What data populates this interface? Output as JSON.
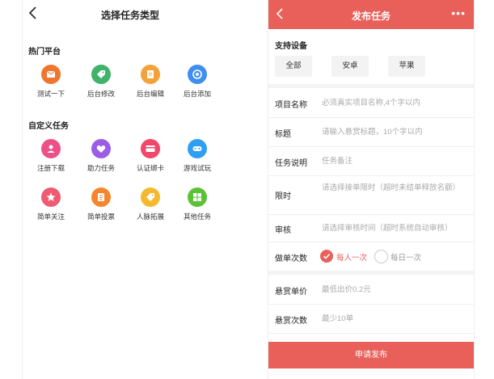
{
  "left": {
    "title": "选择任务类型",
    "hot_section": "热门平台",
    "hot_items": [
      {
        "label": "测试一下",
        "icon": "envelope-icon",
        "color": "#f0752d"
      },
      {
        "label": "后台修改",
        "icon": "tag-icon",
        "color": "#3fb36a"
      },
      {
        "label": "后台编辑",
        "icon": "document-icon",
        "color": "#f5a13b"
      },
      {
        "label": "后台添加",
        "icon": "target-icon",
        "color": "#3f8ef0"
      }
    ],
    "custom_section": "自定义任务",
    "custom_items": [
      {
        "label": "注册下载",
        "icon": "user-icon",
        "color": "#ee4f87"
      },
      {
        "label": "助力任务",
        "icon": "heart-icon",
        "color": "#9b5de5"
      },
      {
        "label": "认证绑卡",
        "icon": "card-icon",
        "color": "#f0476a"
      },
      {
        "label": "游戏试玩",
        "icon": "gamepad-icon",
        "color": "#2e9ff0"
      },
      {
        "label": "简单关注",
        "icon": "star-icon",
        "color": "#ef5a73"
      },
      {
        "label": "简单投票",
        "icon": "list-icon",
        "color": "#f5862e"
      },
      {
        "label": "人脉拓展",
        "icon": "tag-icon",
        "color": "#f5b82e"
      },
      {
        "label": "其他任务",
        "icon": "apps-icon",
        "color": "#5bc236"
      }
    ]
  },
  "right": {
    "title": "发布任务",
    "more": "•••",
    "support_label": "支持设备",
    "devices": [
      "全部",
      "安卓",
      "苹果"
    ],
    "form": {
      "project_name_label": "项目名称",
      "project_name_placeholder": "必须真实项目名称,4个字以内",
      "title_label": "标题",
      "title_placeholder": "请输入悬赏标题，10个字以内",
      "desc_label": "任务说明",
      "desc_placeholder": "任务备注",
      "limit_label": "限时",
      "limit_placeholder": "请选择接单限时（超时未结单释放名额）",
      "review_label": "审核",
      "review_placeholder": "请选择审核时间（超时系统自动审核）",
      "times_label": "做单次数",
      "times_option_1": "每人一次",
      "times_option_2": "每日一次",
      "price_label": "悬赏单价",
      "price_placeholder": "最低出价0.2元",
      "count_label": "悬赏次数",
      "count_placeholder": "最少10单"
    },
    "submit_label": "申请发布"
  }
}
